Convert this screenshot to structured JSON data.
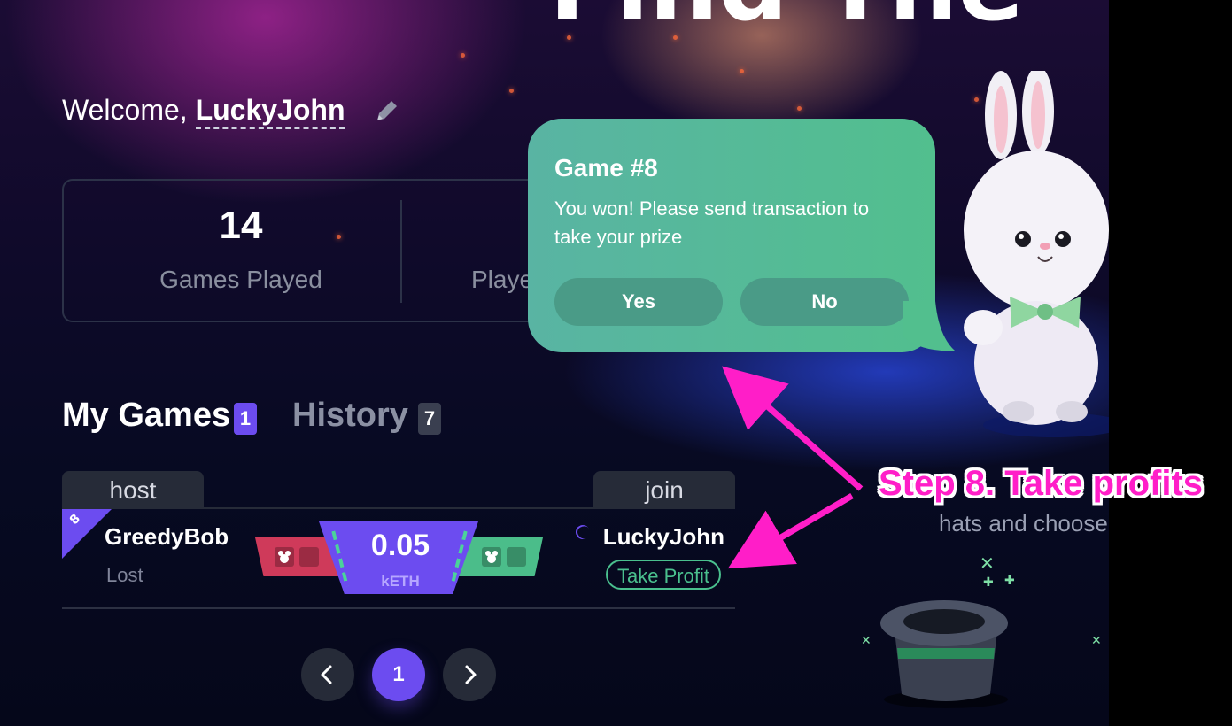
{
  "banner": {
    "title": "Find The"
  },
  "user": {
    "welcome_prefix": "Welcome,",
    "name": "LuckyJohn"
  },
  "stats": [
    {
      "value": "14",
      "label": "Games Played"
    },
    {
      "value": "",
      "label": "Playe"
    }
  ],
  "tabs": [
    {
      "label": "My Games",
      "count": "1",
      "active": true
    },
    {
      "label": "History",
      "count": "7",
      "active": false
    }
  ],
  "table": {
    "host_header": "host",
    "join_header": "join",
    "rows": [
      {
        "game_number": "8",
        "host_name": "GreedyBob",
        "host_status": "Lost",
        "bet_value": "0.05",
        "bet_unit": "kETH",
        "join_name": "LuckyJohn",
        "join_action": "Take Profit"
      }
    ]
  },
  "pagination": {
    "prev_icon": "chevron-left-icon",
    "current_page": "1",
    "next_icon": "chevron-right-icon"
  },
  "dialog": {
    "title": "Game #8",
    "message": "You won! Please send transaction to take your prize",
    "yes_label": "Yes",
    "no_label": "No"
  },
  "side_text": {
    "line1": "hats and choose"
  },
  "annotation": {
    "text": "Step 8. Take profits",
    "color": "#ff1ec8"
  },
  "colors": {
    "accent": "#6c4cf0",
    "win_green": "#4ac08e",
    "lose_red": "#cf3a5a",
    "dialog": "#55b99a"
  }
}
